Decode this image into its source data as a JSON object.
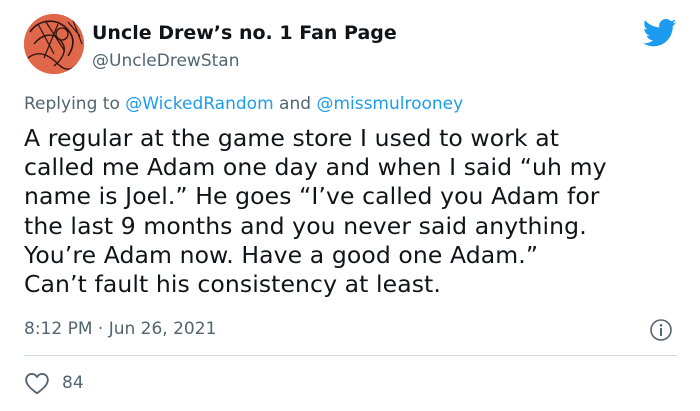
{
  "author": {
    "display_name": "Uncle Drew’s no. 1 Fan Page",
    "handle": "@UncleDrewStan",
    "avatar_icon": "avatar-sketch-icon"
  },
  "reply": {
    "prefix": "Replying to ",
    "mention_1": "@WickedRandom",
    "joiner": " and ",
    "mention_2": "@missmulrooney"
  },
  "body": "A regular at the game store I used to work at\ncalled me Adam one day and when I said “uh my\nname is Joel.” He goes “I’ve called you Adam for\nthe last 9 months and you never said anything.\nYou’re Adam now. Have a good one Adam.”\nCan’t fault his consistency at least.",
  "meta": {
    "timestamp": "8:12 PM · Jun 26, 2021"
  },
  "stats": {
    "likes": "84"
  },
  "colors": {
    "accent": "#1d9bf0",
    "muted_text": "#536471",
    "avatar_bg": "#e0674a"
  },
  "icons": {
    "platform": "twitter-bird-icon",
    "info": "info-icon",
    "like": "heart-icon"
  }
}
